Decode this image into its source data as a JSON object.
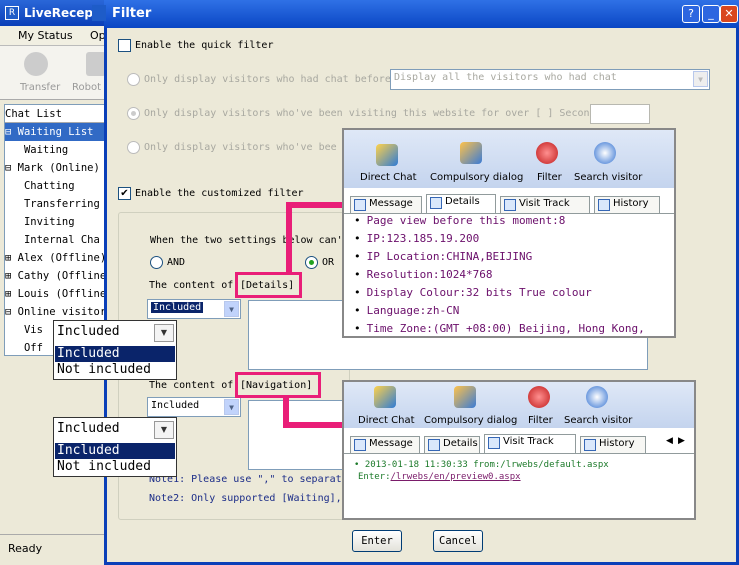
{
  "bg_app": {
    "title": "LiveReception",
    "menu1": "My Status",
    "menu2": "Op",
    "tool1": "Transfer",
    "tool2": "Robot",
    "tree": [
      {
        "label": "Chat List",
        "sel": false
      },
      {
        "label": "⊟ Waiting List",
        "sel": true
      },
      {
        "label": "   Waiting",
        "sel": false
      },
      {
        "label": "⊟ Mark (Online)",
        "sel": false
      },
      {
        "label": "   Chatting",
        "sel": false
      },
      {
        "label": "   Transferring",
        "sel": false
      },
      {
        "label": "   Inviting",
        "sel": false
      },
      {
        "label": "   Internal Cha",
        "sel": false
      },
      {
        "label": "⊞ Alex (Offline)",
        "sel": false
      },
      {
        "label": "⊞ Cathy (Offline",
        "sel": false
      },
      {
        "label": "⊞ Louis (Offline",
        "sel": false
      },
      {
        "label": "⊟ Online visitor",
        "sel": false
      },
      {
        "label": "   Vis",
        "sel": false
      },
      {
        "label": "   Off",
        "sel": false
      }
    ],
    "status": "Ready"
  },
  "dialog": {
    "title": "Filter",
    "quick_filter_label": "Enable the quick filter",
    "opt1_label": "Only display visitors who had chat before",
    "opt1_select": "Display all the visitors who had chat",
    "opt2_label": "Only display visitors who've been visiting this website for over [ ] Secon",
    "opt3_label": "Only display visitors who've bee",
    "custom_filter_label": "Enable the customized filter",
    "settings_text": "When the two settings below can'",
    "and_label": "AND",
    "or_label": "OR",
    "details_prefix": "The content of",
    "details_box": "[Details]",
    "details_select": "Included",
    "nav_prefix": "The content of",
    "nav_box": "[Navigation]",
    "nav_select": "Included",
    "note1": "Note1: Please use \",\" to separat",
    "note2": "Note2: Only supported [Waiting],",
    "enter_label": "Enter",
    "cancel_label": "Cancel"
  },
  "popup1": {
    "current": "Included",
    "options": [
      "Included",
      "Not included"
    ]
  },
  "popup2": {
    "current": "Included",
    "options": [
      "Included",
      "Not included"
    ]
  },
  "panel1": {
    "toolbar": [
      "Direct Chat",
      "Compulsory dialog",
      "Filter",
      "Search visitor"
    ],
    "tabs": [
      "Message",
      "Details",
      "Visit Track",
      "History"
    ],
    "lines": [
      {
        "key": "Page",
        "value": " view before this moment:8"
      },
      {
        "key": "IP:",
        "value": "123.185.19.200"
      },
      {
        "key": "IP Location:",
        "value": "CHINA,BEIJING"
      },
      {
        "key": "Resolution:",
        "value": "1024*768"
      },
      {
        "key": "Display Colour:",
        "value": "32 bits True colour"
      },
      {
        "key": "Language:",
        "value": "zh-CN"
      },
      {
        "key": "Time Zone:",
        "value": "(GMT +08:00) Beijing, Hong Kong,"
      }
    ]
  },
  "panel2": {
    "toolbar": [
      "Direct Chat",
      "Compulsory dialog",
      "Filter",
      "Search visitor"
    ],
    "tabs": [
      "Message",
      "Details",
      "Visit Track",
      "History"
    ],
    "track_line": "2013-01-18 11:30:33 from:/lrwebs/default.aspx",
    "track_prefix": "Enter:",
    "track_link": "/lrwebs/en/preview0.aspx"
  },
  "colors": {
    "accent": "#e91e78",
    "title_bar": "#0a46c4",
    "dialog_bg": "#ece9d8"
  }
}
